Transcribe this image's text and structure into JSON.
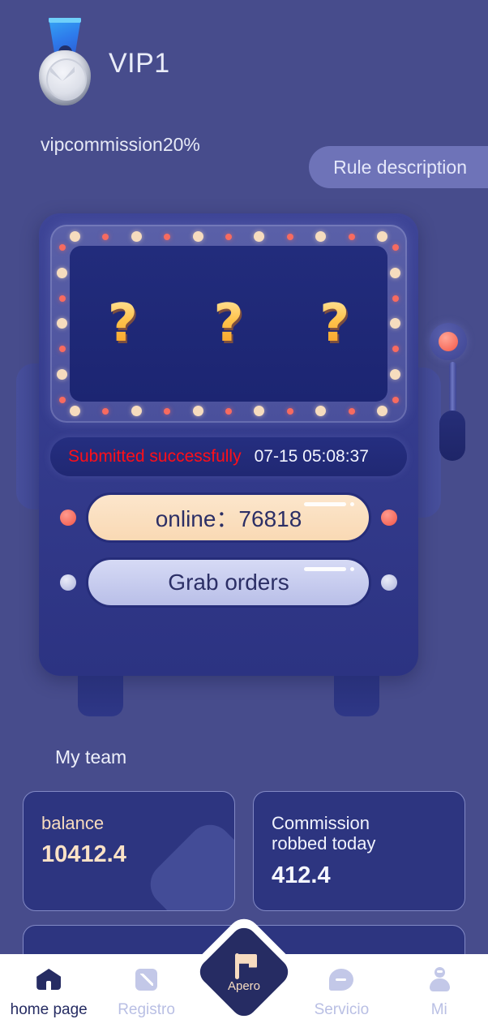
{
  "header": {
    "medal_icon": "medal-icon",
    "vip_level": "VIP1",
    "vip_commission": "vipcommission20%",
    "rule_button": "Rule description"
  },
  "machine": {
    "reels": [
      "?",
      "?",
      "?"
    ],
    "status_text": "Submitted successfully",
    "status_time": "07-15 05:08:37",
    "online_button": "online：76818",
    "grab_button": "Grab orders",
    "lever_icon": "lever-icon",
    "led_red": "red-led-icon",
    "led_grey": "grey-led-icon"
  },
  "team": {
    "section_title": "My team",
    "cards": [
      {
        "label": "balance",
        "value": "10412.4"
      },
      {
        "label": "Commission\nrobbed today",
        "value": "412.4"
      }
    ]
  },
  "nav": {
    "items": [
      {
        "label": "home page",
        "icon": "home-icon",
        "active": true
      },
      {
        "label": "Registro",
        "icon": "edit-icon",
        "active": false
      },
      {
        "label": "Servicio",
        "icon": "chat-icon",
        "active": false
      },
      {
        "label": "Mi",
        "icon": "user-icon",
        "active": false
      }
    ],
    "center": {
      "label": "Apero",
      "icon": "flag-icon"
    }
  },
  "colors": {
    "background": "#474C8C",
    "machine_body": "#333A8B",
    "screen": "#1C2572",
    "accent_red": "#FF0F18",
    "cream": "#F7DCC0",
    "lavender": "#B9BFE8",
    "nav_active": "#262C63",
    "nav_inactive": "#B9BFE4"
  }
}
